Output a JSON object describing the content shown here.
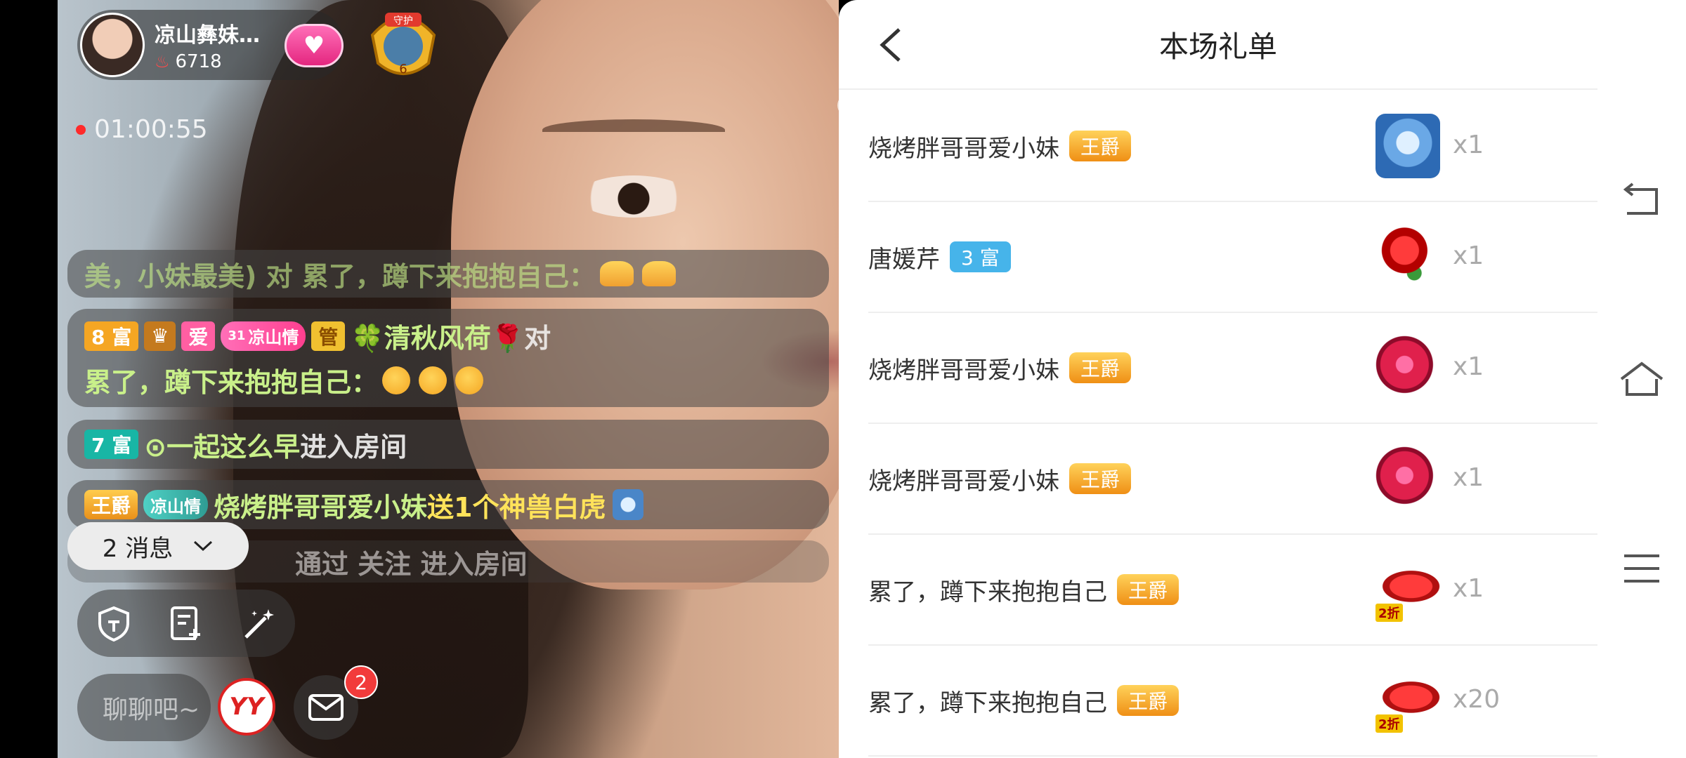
{
  "host": {
    "name": "凉山彝妹…",
    "heat": "6718",
    "guard_badge_text": "守护",
    "guard_level": "6"
  },
  "stream": {
    "timer": "01:00:55"
  },
  "chat": {
    "partial_top": "美，小妹最美) 对 累了，蹲下来抱抱自己：",
    "msg1": {
      "rich_badge": "8 富",
      "love_badge": "爱",
      "fan_badge": "凉山情",
      "fan_level": "31",
      "mgr_badge": "管",
      "sender": "🍀清秋风荷🌹",
      "text_before": " 对 ",
      "target": "累了，蹲下来抱抱自己：",
      "emoji_count": 3
    },
    "msg2": {
      "rich_badge": "7 富",
      "sender": "⊙一起这么早",
      "text": " 进入房间"
    },
    "msg3": {
      "king_badge": "王爵",
      "fan_badge": "凉山情",
      "sender": "烧烤胖哥哥爱小妹",
      "text": " 送1个神兽白虎"
    },
    "partial_bottom": "通过 关注 进入房间"
  },
  "message_toggle": {
    "label": "2 消息"
  },
  "input": {
    "placeholder": "聊聊吧~"
  },
  "brand_button": {
    "label": "YY"
  },
  "mail": {
    "badge": "2"
  },
  "panel": {
    "title": "本场礼单",
    "rows": [
      {
        "sender": "烧烤胖哥哥爱小妹",
        "level": "王爵",
        "level_type": "king",
        "gift": "tiger",
        "count": "x1"
      },
      {
        "sender": "唐媛芹",
        "level": "3 富",
        "level_type": "rich",
        "gift": "rose",
        "count": "x1"
      },
      {
        "sender": "烧烤胖哥哥爱小妹",
        "level": "王爵",
        "level_type": "king",
        "gift": "apple",
        "count": "x1"
      },
      {
        "sender": "烧烤胖哥哥爱小妹",
        "level": "王爵",
        "level_type": "king",
        "gift": "apple",
        "count": "x1"
      },
      {
        "sender": "累了，蹲下来抱抱自己",
        "level": "王爵",
        "level_type": "king",
        "gift": "car",
        "gift_tag": "2折",
        "count": "x1"
      },
      {
        "sender": "累了，蹲下来抱抱自己",
        "level": "王爵",
        "level_type": "king",
        "gift": "car",
        "gift_tag": "2折",
        "count": "x20"
      }
    ]
  },
  "nav": {
    "icons": [
      "back-nav-icon",
      "home-nav-icon",
      "menu-nav-icon"
    ]
  },
  "colors": {
    "accent_red": "#f23b3b",
    "king_gold": "#ef8f15",
    "rich_blue": "#46b4ea"
  }
}
